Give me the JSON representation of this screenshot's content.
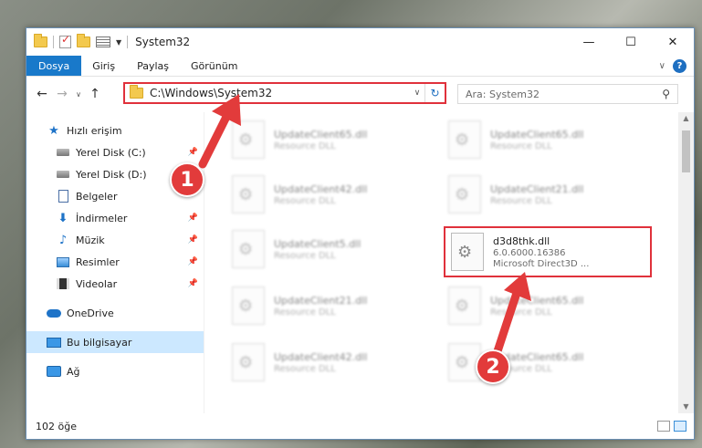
{
  "window": {
    "title": "System32",
    "minimize": "—",
    "maximize": "☐",
    "close": "✕"
  },
  "ribbon": {
    "tabs": [
      "Dosya",
      "Giriş",
      "Paylaş",
      "Görünüm"
    ],
    "help": "?"
  },
  "address": {
    "path": "C:\\Windows\\System32",
    "search_placeholder": "Ara: System32"
  },
  "nav": {
    "quick_access": "Hızlı erişim",
    "items": [
      {
        "label": "Yerel Disk (C:)",
        "pinned": true
      },
      {
        "label": "Yerel Disk (D:)",
        "pinned": true
      },
      {
        "label": "Belgeler",
        "pinned": false
      },
      {
        "label": "İndirmeler",
        "pinned": true
      },
      {
        "label": "Müzik",
        "pinned": true
      },
      {
        "label": "Resimler",
        "pinned": true
      },
      {
        "label": "Videolar",
        "pinned": true
      }
    ],
    "onedrive": "OneDrive",
    "this_pc": "Bu bilgisayar",
    "network": "Ağ"
  },
  "files": [
    {
      "name": "UpdateClient65.dll",
      "desc": "Resource DLL"
    },
    {
      "name": "UpdateClient65.dll",
      "desc": "Resource DLL"
    },
    {
      "name": "UpdateClient42.dll",
      "desc": "Resource DLL"
    },
    {
      "name": "UpdateClient21.dll",
      "desc": "Resource DLL"
    },
    {
      "name": "UpdateClient5.dll",
      "desc": "Resource DLL"
    },
    {
      "name": "d3d8thk.dll",
      "version": "6.0.6000.16386",
      "desc": "Microsoft Direct3D ..."
    },
    {
      "name": "UpdateClient21.dll",
      "desc": "Resource DLL"
    },
    {
      "name": "UpdateClient65.dll",
      "desc": "Resource DLL"
    },
    {
      "name": "UpdateClient42.dll",
      "desc": "Resource DLL"
    },
    {
      "name": "UpdateClient65.dll",
      "desc": "Resource DLL"
    }
  ],
  "status": {
    "count": "102 öğe"
  },
  "annotations": {
    "step1": "1",
    "step2": "2",
    "color": "#e23b3b"
  }
}
